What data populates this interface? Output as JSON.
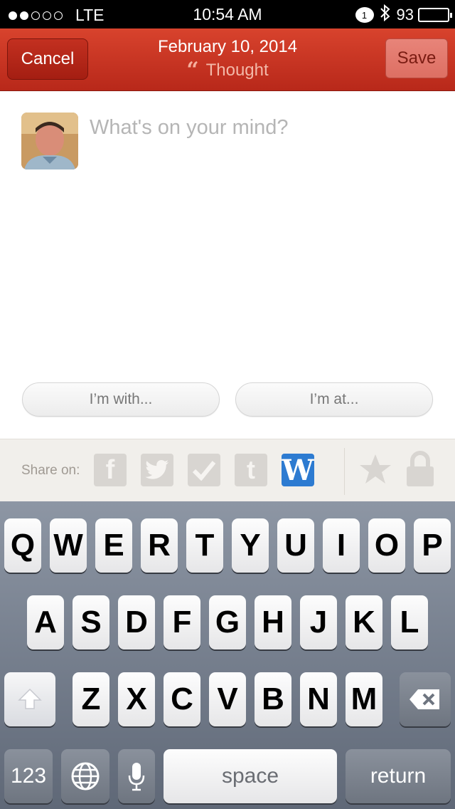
{
  "status_bar": {
    "carrier": "LTE",
    "time": "10:54 AM",
    "notification_count": "1",
    "battery": "93",
    "battery_level": 0.93,
    "signal_bars_filled": 2,
    "signal_bars_total": 5
  },
  "nav": {
    "cancel_label": "Cancel",
    "save_label": "Save",
    "date": "February 10, 2014",
    "entry_type": "Thought"
  },
  "compose": {
    "placeholder": "What's on your mind?",
    "with_label": "I’m with...",
    "at_label": "I’m at..."
  },
  "share": {
    "label": "Share on:",
    "services": [
      "facebook-icon",
      "twitter-icon",
      "checkin-icon",
      "tumblr-icon",
      "wordpress-icon"
    ],
    "active_service": "wordpress-icon"
  },
  "keyboard": {
    "row1": [
      "Q",
      "W",
      "E",
      "R",
      "T",
      "Y",
      "U",
      "I",
      "O",
      "P"
    ],
    "row2": [
      "A",
      "S",
      "D",
      "F",
      "G",
      "H",
      "J",
      "K",
      "L"
    ],
    "row3": [
      "Z",
      "X",
      "C",
      "V",
      "B",
      "N",
      "M"
    ],
    "numbers_label": "123",
    "space_label": "space",
    "return_label": "return"
  },
  "colors": {
    "nav_red": "#c7321f",
    "wordpress_blue": "#2d7bd1",
    "share_bg": "#f1efeb"
  }
}
